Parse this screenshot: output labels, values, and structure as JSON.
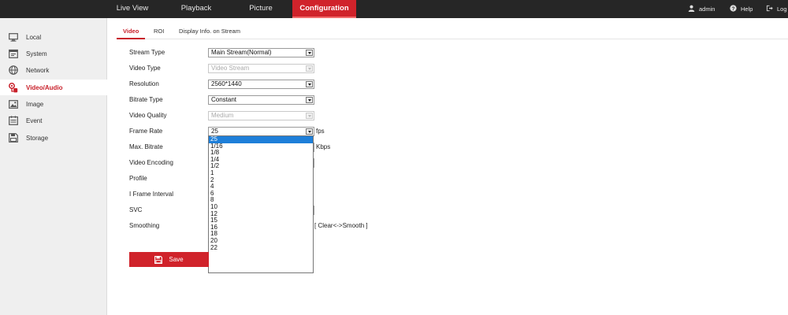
{
  "nav": {
    "items": [
      {
        "label": "Live View"
      },
      {
        "label": "Playback"
      },
      {
        "label": "Picture"
      },
      {
        "label": "Configuration"
      }
    ],
    "user": "admin",
    "help": "Help",
    "logout": "Log"
  },
  "sidebar": {
    "items": [
      {
        "label": "Local",
        "icon": "monitor-icon"
      },
      {
        "label": "System",
        "icon": "system-icon"
      },
      {
        "label": "Network",
        "icon": "globe-icon"
      },
      {
        "label": "Video/Audio",
        "icon": "video-audio-icon"
      },
      {
        "label": "Image",
        "icon": "image-icon"
      },
      {
        "label": "Event",
        "icon": "event-icon"
      },
      {
        "label": "Storage",
        "icon": "storage-icon"
      }
    ],
    "active": "Video/Audio"
  },
  "tabs": [
    {
      "label": "Video"
    },
    {
      "label": "ROI"
    },
    {
      "label": "Display Info. on Stream"
    }
  ],
  "form": {
    "stream_type": {
      "label": "Stream Type",
      "value": "Main Stream(Normal)"
    },
    "video_type": {
      "label": "Video Type",
      "value": "Video Stream"
    },
    "resolution": {
      "label": "Resolution",
      "value": "2560*1440"
    },
    "bitrate_type": {
      "label": "Bitrate Type",
      "value": "Constant"
    },
    "video_quality": {
      "label": "Video Quality",
      "value": "Medium"
    },
    "frame_rate": {
      "label": "Frame Rate",
      "value": "25",
      "unit": "fps"
    },
    "max_bitrate": {
      "label": "Max. Bitrate",
      "unit": "Kbps"
    },
    "video_encoding": {
      "label": "Video Encoding"
    },
    "profile": {
      "label": "Profile"
    },
    "i_frame_interval": {
      "label": "I Frame Interval"
    },
    "svc": {
      "label": "SVC"
    },
    "smoothing": {
      "label": "Smoothing",
      "hint": "[ Clear<->Smooth ]"
    }
  },
  "frame_rate_options": [
    "25",
    "1/16",
    "1/8",
    "1/4",
    "1/2",
    "1",
    "2",
    "4",
    "6",
    "8",
    "10",
    "12",
    "15",
    "16",
    "18",
    "20",
    "22"
  ],
  "frame_rate_selected": "25",
  "save_label": "Save",
  "colors": {
    "accent": "#d0232b",
    "topbar": "#262626",
    "sidebar": "#efefef",
    "selection": "#1e7fd9"
  }
}
